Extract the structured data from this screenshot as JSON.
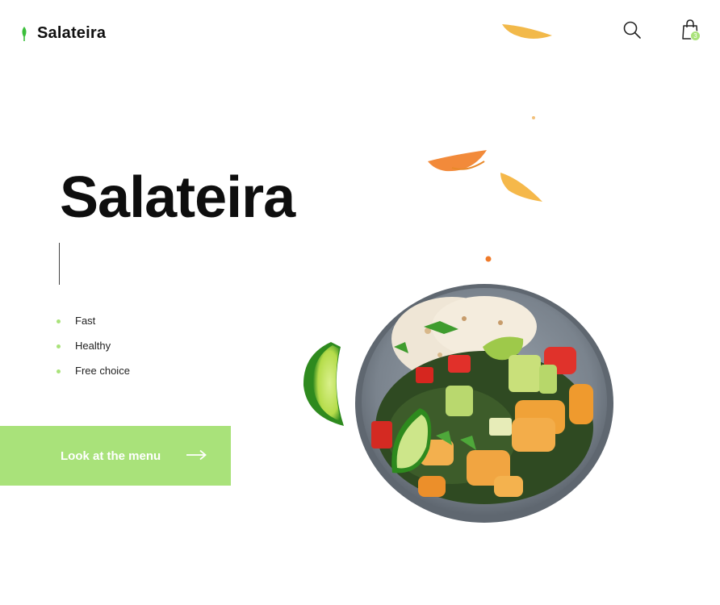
{
  "brand": {
    "name": "Salateira",
    "logo_icon": "leaf-icon",
    "accent_color": "#a9e27a"
  },
  "header": {
    "search_icon": "search-icon",
    "cart_icon": "shopping-bag-icon",
    "cart_count": "3"
  },
  "hero": {
    "title": "Salateira",
    "features": [
      {
        "label": "Fast"
      },
      {
        "label": "Healthy"
      },
      {
        "label": "Free choice"
      }
    ],
    "cta": {
      "label": "Look at the menu",
      "icon": "arrow-right-icon"
    }
  },
  "images": {
    "bowl": "salad-bowl-image",
    "lime": "lime-slice-image",
    "petals": "falling-petals-image"
  }
}
